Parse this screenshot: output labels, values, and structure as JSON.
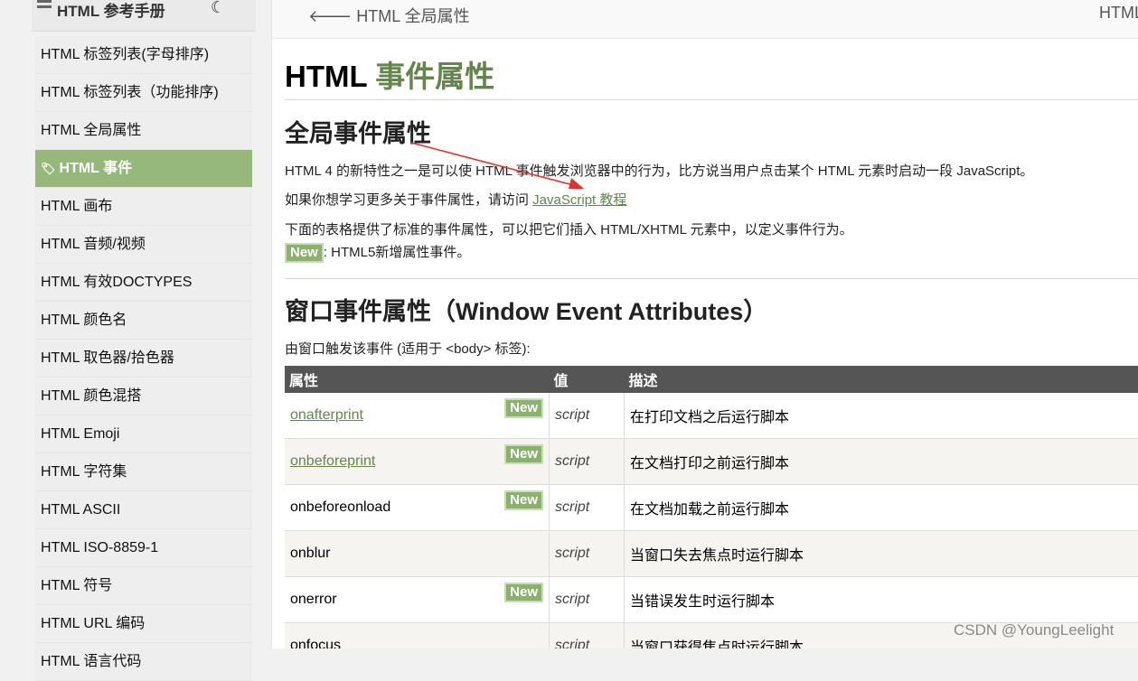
{
  "sidebar": {
    "title": "HTML 参考手册",
    "items": [
      {
        "label": "HTML 标签列表(字母排序)"
      },
      {
        "label": "HTML 标签列表（功能排序)"
      },
      {
        "label": "HTML 全局属性"
      },
      {
        "label": "HTML 事件",
        "active": true
      },
      {
        "label": "HTML 画布"
      },
      {
        "label": "HTML 音频/视频"
      },
      {
        "label": "HTML 有效DOCTYPES"
      },
      {
        "label": "HTML 颜色名"
      },
      {
        "label": "HTML 取色器/拾色器"
      },
      {
        "label": "HTML 颜色混搭"
      },
      {
        "label": "HTML Emoji"
      },
      {
        "label": "HTML 字符集"
      },
      {
        "label": "HTML ASCII"
      },
      {
        "label": "HTML ISO-8859-1"
      },
      {
        "label": "HTML 符号"
      },
      {
        "label": "HTML URL 编码"
      },
      {
        "label": "HTML 语言代码"
      }
    ]
  },
  "topbar": {
    "back_label": "HTML 全局属性",
    "next_label": "HTML"
  },
  "page": {
    "title_prefix": "HTML",
    "title_accent": "事件属性",
    "section1_title": "全局事件属性",
    "p1": "HTML 4 的新特性之一是可以使 HTML 事件触发浏览器中的行为，比方说当用户点击某个 HTML 元素时启动一段 JavaScript。",
    "p2_text": "如果你想学习更多关于事件属性，请访问 ",
    "p2_link": "JavaScript 教程",
    "p3": "下面的表格提供了标准的事件属性，可以把它们插入 HTML/XHTML 元素中，以定义事件行为。",
    "new_badge": "New",
    "p4": ": HTML5新增属性事件。",
    "section2_title": "窗口事件属性（Window Event Attributes）",
    "p5": "由窗口触发该事件 (适用于 <body> 标签):"
  },
  "table": {
    "headers": [
      "属性",
      "值",
      "描述"
    ],
    "rows": [
      {
        "attr": "onafterprint",
        "link": true,
        "new": true,
        "value": "script",
        "desc": "在打印文档之后运行脚本"
      },
      {
        "attr": "onbeforeprint",
        "link": true,
        "new": true,
        "value": "script",
        "desc": "在文档打印之前运行脚本"
      },
      {
        "attr": "onbeforeonload",
        "link": false,
        "new": true,
        "value": "script",
        "desc": "在文档加载之前运行脚本"
      },
      {
        "attr": "onblur",
        "link": false,
        "new": false,
        "value": "script",
        "desc": "当窗口失去焦点时运行脚本"
      },
      {
        "attr": "onerror",
        "link": false,
        "new": true,
        "value": "script",
        "desc": "当错误发生时运行脚本"
      },
      {
        "attr": "onfocus",
        "link": false,
        "new": false,
        "value": "script",
        "desc": "当窗口获得焦点时运行脚本"
      }
    ]
  },
  "watermark": "CSDN @YoungLeelight",
  "colors": {
    "accent": "#64854c",
    "active_nav": "#96b97b",
    "badge": "#8ab26d",
    "table_header": "#555555",
    "annotation_arrow": "#e0322f"
  }
}
